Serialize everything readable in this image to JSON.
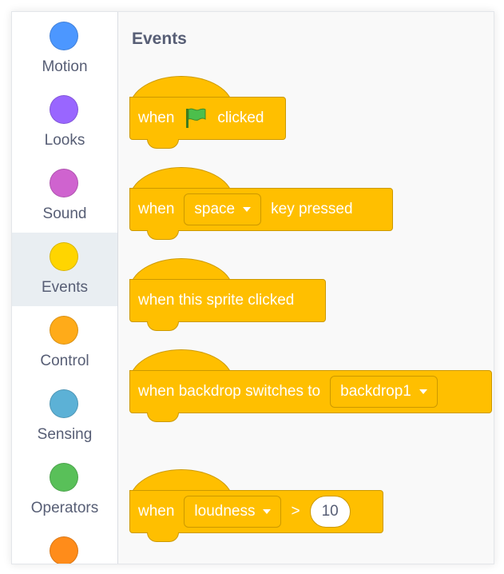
{
  "sidebar": {
    "categories": [
      {
        "label": "Motion",
        "color": "#4c97ff"
      },
      {
        "label": "Looks",
        "color": "#9966ff"
      },
      {
        "label": "Sound",
        "color": "#cf63cf"
      },
      {
        "label": "Events",
        "color": "#ffd500",
        "selected": true
      },
      {
        "label": "Control",
        "color": "#ffab19"
      },
      {
        "label": "Sensing",
        "color": "#5cb1d6"
      },
      {
        "label": "Operators",
        "color": "#59c059"
      },
      {
        "label": "",
        "color": "#ff8c1a"
      }
    ]
  },
  "palette": {
    "title": "Events",
    "block_color": "#ffbf00",
    "blocks": {
      "flag_clicked": {
        "when": "when",
        "flag_icon": "green-flag-icon",
        "clicked": "clicked"
      },
      "key_pressed": {
        "when": "when",
        "key": "space",
        "suffix": "key pressed"
      },
      "sprite_clicked": {
        "text": "when this sprite clicked"
      },
      "backdrop_switch": {
        "text": "when backdrop switches to",
        "backdrop": "backdrop1"
      },
      "loudness": {
        "when": "when",
        "sensor": "loudness",
        "operator": ">",
        "value": "10"
      }
    }
  }
}
